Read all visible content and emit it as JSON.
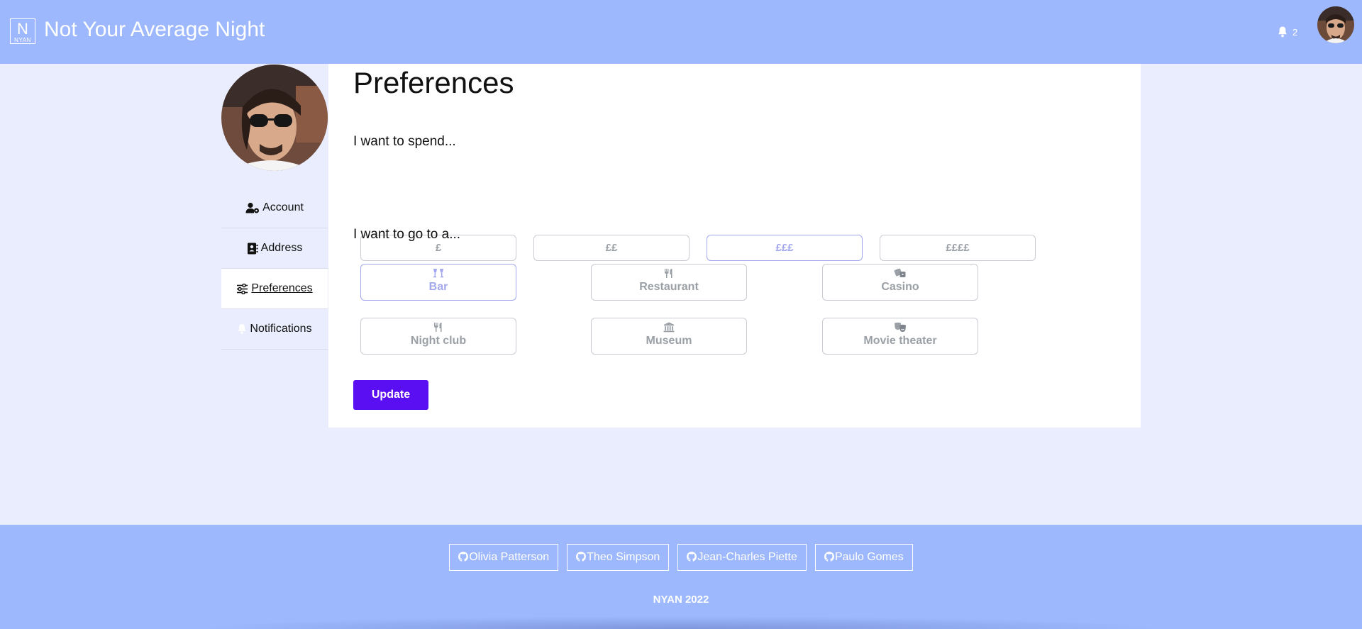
{
  "header": {
    "logo_big": "N",
    "logo_small": "NYAN",
    "title": "Not Your Average Night",
    "notification_count": "2"
  },
  "sidebar": {
    "items": [
      {
        "label": "Account",
        "icon": "user-gear-icon"
      },
      {
        "label": "Address",
        "icon": "address-book-icon"
      },
      {
        "label": "Preferences",
        "icon": "sliders-icon",
        "active": true
      },
      {
        "label": "Notifications",
        "icon": "bell-icon"
      }
    ]
  },
  "main": {
    "title": "Preferences",
    "spend_label": "I want to spend...",
    "spend_options": [
      "£",
      "££",
      "£££",
      "££££"
    ],
    "spend_selected": "£££",
    "goto_label": "I want to go to a...",
    "places": [
      {
        "label": "Bar",
        "icon": "cocktail-glasses-icon",
        "selected": true
      },
      {
        "label": "Restaurant",
        "icon": "utensils-icon"
      },
      {
        "label": "Casino",
        "icon": "dice-icon"
      },
      {
        "label": "Night club",
        "icon": "utensils-icon"
      },
      {
        "label": "Museum",
        "icon": "museum-icon"
      },
      {
        "label": "Movie theater",
        "icon": "masks-theater-icon"
      }
    ],
    "update_label": "Update"
  },
  "footer": {
    "links": [
      "Olivia Patterson",
      "Theo Simpson",
      "Jean-Charles Piette",
      "Paulo Gomes"
    ],
    "copyright": "NYAN 2022"
  },
  "colors": {
    "header_bg": "#9db8fc",
    "page_bg": "#eaedfd",
    "accent": "#5a0ef2",
    "selected": "#a3a7ee"
  }
}
